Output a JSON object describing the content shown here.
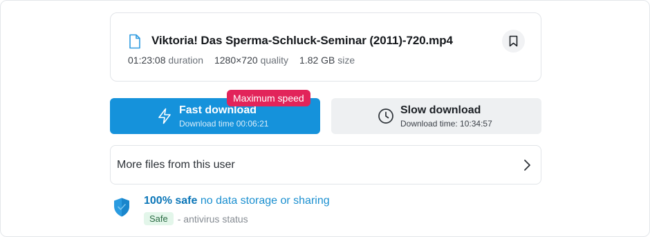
{
  "file": {
    "name": "Viktoria! Das Sperma-Schluck-Seminar (2011)-720.mp4",
    "duration_value": "01:23:08",
    "duration_label": "duration",
    "quality_value": "1280×720",
    "quality_label": "quality",
    "size_value": "1.82 GB",
    "size_label": "size"
  },
  "badge": {
    "label": "Maximum speed"
  },
  "fast_download": {
    "title": "Fast download",
    "subtitle": "Download time 00:06:21"
  },
  "slow_download": {
    "title": "Slow download",
    "subtitle": "Download time: 10:34:57"
  },
  "more_files": {
    "label": "More files from this user"
  },
  "safety": {
    "strong": "100% safe",
    "rest": "no data storage or sharing",
    "badge": "Safe",
    "status": "- antivirus status"
  },
  "icons": {
    "file": "file-icon",
    "bookmark": "bookmark-icon",
    "fast": "lightning-icon",
    "slow": "clock-icon",
    "more": "chevron-right-icon",
    "safety": "shield-check-icon"
  },
  "colors": {
    "accent": "#1592db",
    "badge": "#e2245a",
    "safe_text": "#0b76b8",
    "safe_badge_bg": "#e3f6ea"
  }
}
